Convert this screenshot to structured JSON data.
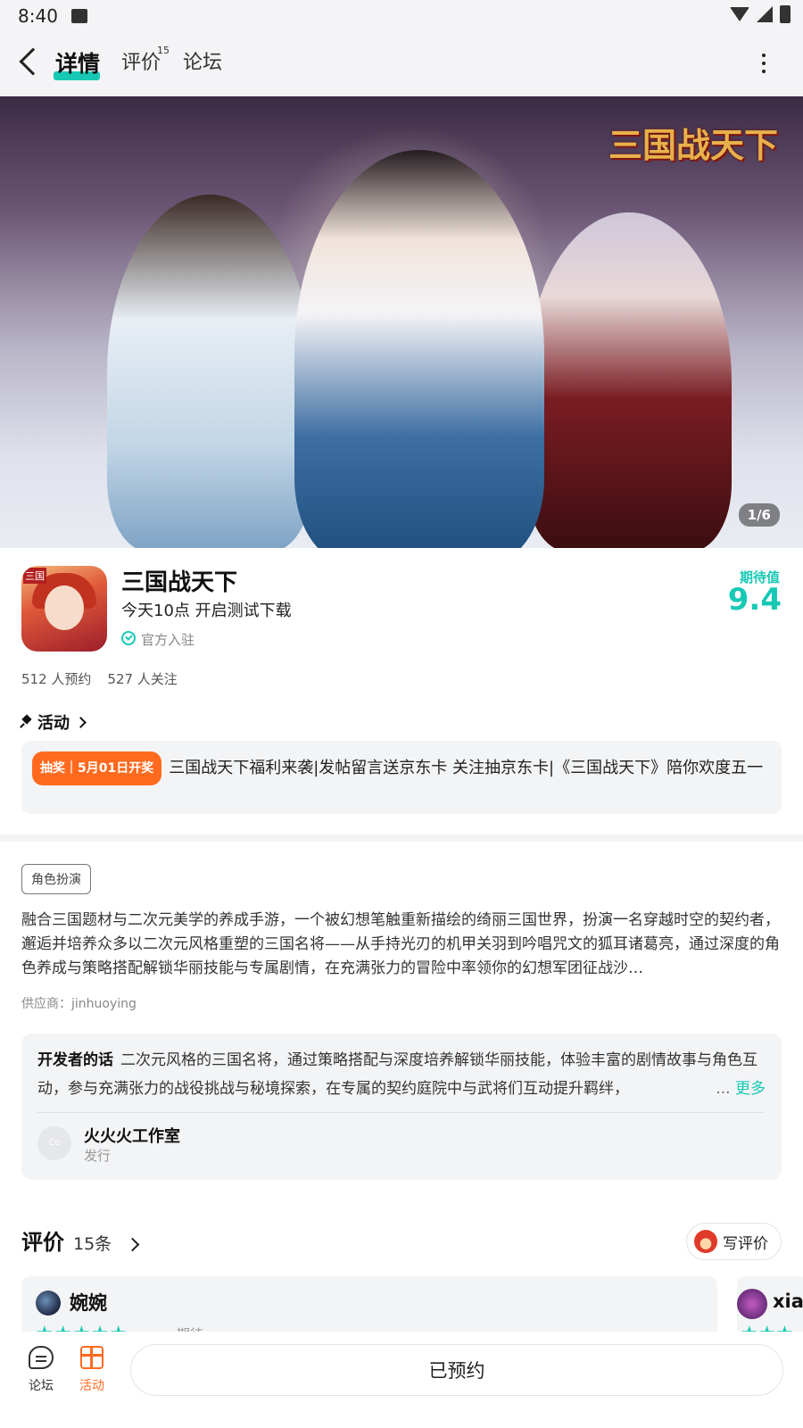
{
  "status_bar": {
    "time": "8:40"
  },
  "nav": {
    "tabs": [
      {
        "label": "详情"
      },
      {
        "label": "评价",
        "count": "15"
      },
      {
        "label": "论坛"
      }
    ]
  },
  "banner": {
    "logo_text": "三国战天下",
    "counter": "1/6"
  },
  "app": {
    "name": "三国战天下",
    "subtitle": "今天10点 开启测试下载",
    "verified": "官方入驻",
    "expect_label": "期待值",
    "expect_score": "9.4",
    "reservations": "512 人预约",
    "followers": "527 人关注",
    "icon_tag": "三国"
  },
  "activity": {
    "title": "活动",
    "badge": "抽奖｜5月01日开奖",
    "text": "三国战天下福利来袭|发帖留言送京东卡 关注抽京东卡|《三国战天下》陪你欢度五一"
  },
  "intro": {
    "tag": "角色扮演",
    "description": "融合三国题材与二次元美学的养成手游，一个被幻想笔触重新描绘的绮丽三国世界，扮演一名穿越时空的契约者，邂逅并培养众多以二次元风格重塑的三国名将——从手持光刃的机甲关羽到吟唱咒文的狐耳诸葛亮，通过深度的角色养成与策略搭配解锁华丽技能与专属剧情，在充满张力的冒险中率领你的幻想军团征战沙…",
    "supplier": "供应商：jinhuoying"
  },
  "developer": {
    "title": "开发者的话",
    "text": "二次元风格的三国名将，通过策略搭配与深度培养解锁华丽技能，体验丰富的剧情故事与角色互动，参与充满张力的战役挑战与秘境探索，在专属的契约庭院中与武将们互动提升羁绊，",
    "ellipsis": "...",
    "more": "更多",
    "studio_name": "火火火工作室",
    "studio_role": "发行",
    "avatar_text": "Co"
  },
  "reviews": {
    "title": "评价",
    "count": "15条",
    "write_button": "写评价",
    "items": [
      {
        "name": "婉婉",
        "stars": "★★★★★",
        "label": "期待"
      },
      {
        "name": "xiao",
        "stars": "★★★"
      }
    ]
  },
  "bottom_bar": {
    "forum_label": "论坛",
    "activity_label": "活动",
    "reserved_button": "已预约"
  },
  "colors": {
    "accent": "#17c9b5",
    "orange": "#ff6a1f"
  }
}
